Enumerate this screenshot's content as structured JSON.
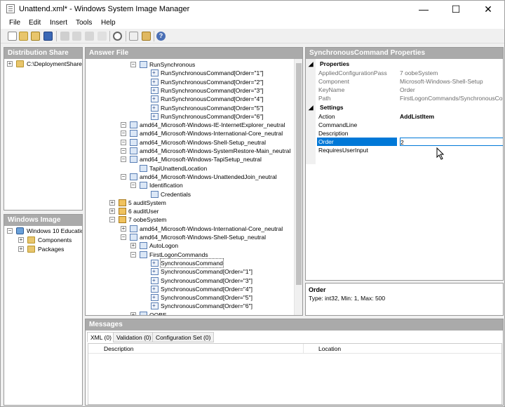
{
  "window": {
    "title": "Unattend.xml* - Windows System Image Manager"
  },
  "menu": [
    "File",
    "Edit",
    "Insert",
    "Tools",
    "Help"
  ],
  "panels": {
    "distribution_share": "Distribution Share",
    "answer_file": "Answer File",
    "properties": "SynchronousCommand Properties",
    "windows_image": "Windows Image",
    "messages": "Messages"
  },
  "distribution": {
    "path": "C:\\DeploymentShare"
  },
  "windows_image": {
    "root": "Windows 10 Educatio",
    "children": [
      "Components",
      "Packages"
    ]
  },
  "answer_tree": [
    "RunSynchronous",
    "RunSynchronousCommand[Order=\"1\"]",
    "RunSynchronousCommand[Order=\"2\"]",
    "RunSynchronousCommand[Order=\"3\"]",
    "RunSynchronousCommand[Order=\"4\"]",
    "RunSynchronousCommand[Order=\"5\"]",
    "RunSynchronousCommand[Order=\"6\"]",
    "amd64_Microsoft-Windows-IE-InternetExplorer_neutral",
    "amd64_Microsoft-Windows-International-Core_neutral",
    "amd64_Microsoft-Windows-Shell-Setup_neutral",
    "amd64_Microsoft-Windows-SystemRestore-Main_neutral",
    "amd64_Microsoft-Windows-TapiSetup_neutral",
    "TapiUnattendLocation",
    "amd64_Microsoft-Windows-UnattendedJoin_neutral",
    "Identification",
    "Credentials",
    "5 auditSystem",
    "6 auditUser",
    "7 oobeSystem",
    "amd64_Microsoft-Windows-International-Core_neutral",
    "amd64_Microsoft-Windows-Shell-Setup_neutral",
    "AutoLogon",
    "FirstLogonCommands",
    "SynchronousCommand",
    "SynchronousCommand[Order=\"1\"]",
    "SynchronousCommand[Order=\"3\"]",
    "SynchronousCommand[Order=\"4\"]",
    "SynchronousCommand[Order=\"5\"]",
    "SynchronousCommand[Order=\"6\"]",
    "OOBE"
  ],
  "properties": {
    "cat_properties": "Properties",
    "cat_settings": "Settings",
    "rows": [
      {
        "name": "AppliedConfigurationPass",
        "value": "7 oobeSystem"
      },
      {
        "name": "Component",
        "value": "Microsoft-Windows-Shell-Setup"
      },
      {
        "name": "KeyName",
        "value": "Order"
      },
      {
        "name": "Path",
        "value": "FirstLogonCommands/SynchronousComm"
      }
    ],
    "settings": [
      {
        "name": "Action",
        "value": "AddListItem"
      },
      {
        "name": "CommandLine",
        "value": ""
      },
      {
        "name": "Description",
        "value": ""
      },
      {
        "name": "Order",
        "value": "2"
      },
      {
        "name": "RequiresUserInput",
        "value": ""
      }
    ]
  },
  "help": {
    "title": "Order",
    "text": "Type: int32, Min: 1, Max: 500"
  },
  "messages": {
    "tabs": [
      "XML (0)",
      "Validation (0)",
      "Configuration Set (0)"
    ],
    "columns": [
      "Description",
      "Location"
    ]
  }
}
